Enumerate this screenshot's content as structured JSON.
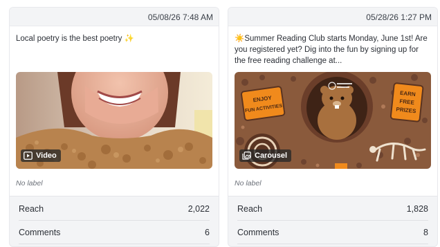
{
  "posts": [
    {
      "timestamp": "05/08/26 7:48 AM",
      "caption": "Local poetry is the best poetry ✨",
      "media_type": "Video",
      "media_icon": "video-icon",
      "label": "No label",
      "metrics": [
        {
          "name": "Reach",
          "value": "2,022"
        },
        {
          "name": "Comments",
          "value": "6"
        }
      ]
    },
    {
      "timestamp": "05/28/26 1:27 PM",
      "caption": "☀️Summer Reading Club starts Monday, June 1st! Are you registered yet? Dig into the fun by signing up for the free reading challenge at...",
      "media_type": "Carousel",
      "media_icon": "carousel-icon",
      "label": "No label",
      "metrics": [
        {
          "name": "Reach",
          "value": "1,828"
        },
        {
          "name": "Comments",
          "value": "8"
        }
      ]
    }
  ],
  "image_text": {
    "sign_left": "ENJOY FUN ACTIVITIES",
    "sign_right": "EARN FREE PRIZES"
  },
  "colors": {
    "card_bg": "#f3f4f6",
    "badge_bg": "#282828",
    "dirt": "#8a5a3c",
    "sign_orange": "#f08a1c"
  }
}
